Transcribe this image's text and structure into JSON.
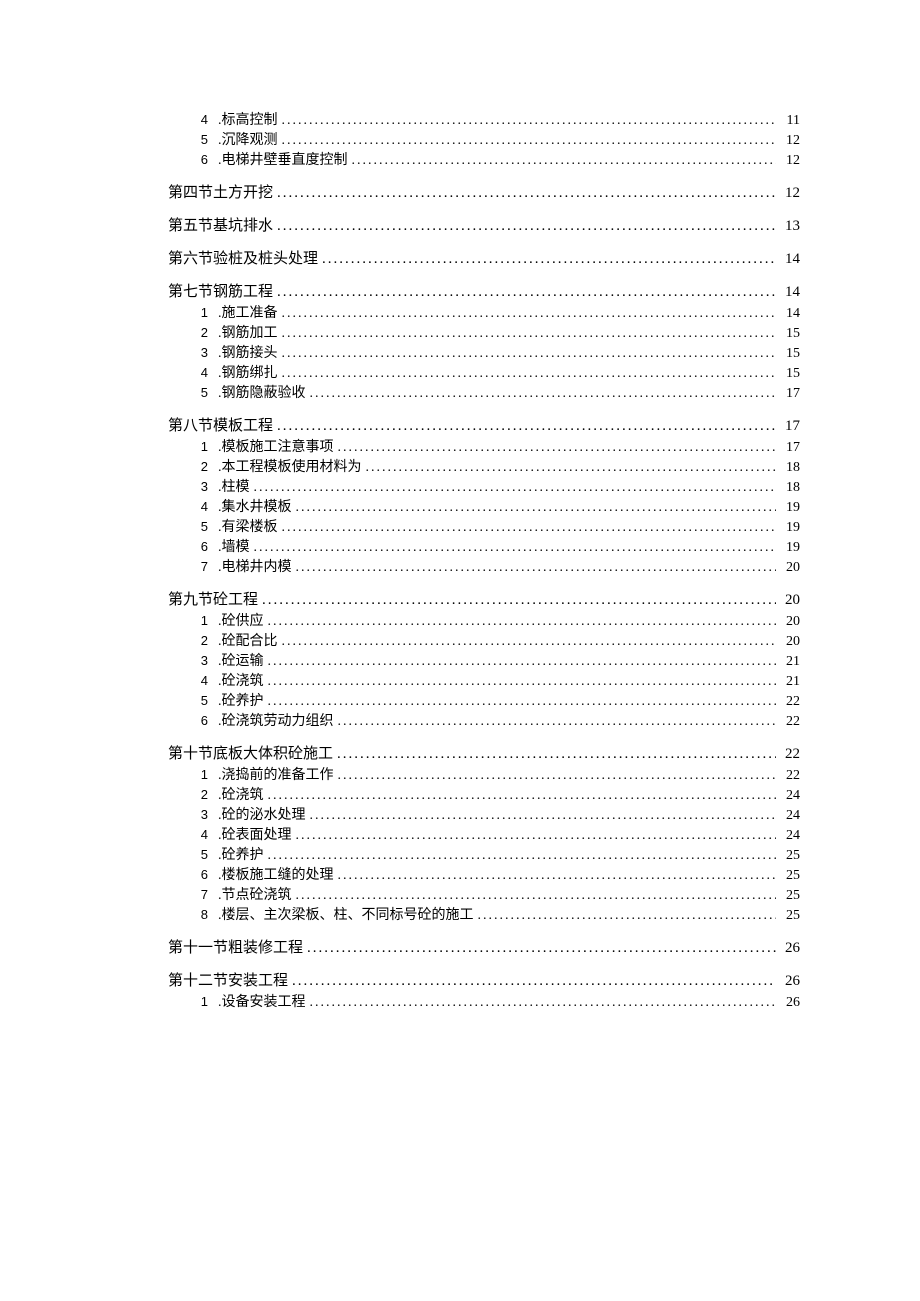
{
  "toc": [
    {
      "level": 2,
      "ord": "4",
      "title": ".标高控制",
      "page": "11"
    },
    {
      "level": 2,
      "ord": "5",
      "title": ".沉降观测",
      "page": "12"
    },
    {
      "level": 2,
      "ord": "6",
      "title": ".电梯井壁垂直度控制",
      "page": "12"
    },
    {
      "level": 1,
      "ord": "",
      "title": "第四节土方开挖",
      "page": "12"
    },
    {
      "level": 1,
      "ord": "",
      "title": "第五节基坑排水",
      "page": "13"
    },
    {
      "level": 1,
      "ord": "",
      "title": "第六节验桩及桩头处理",
      "page": "14"
    },
    {
      "level": 1,
      "ord": "",
      "title": "第七节钢筋工程",
      "page": "14"
    },
    {
      "level": 2,
      "ord": "1",
      "title": ".施工准备",
      "page": "14"
    },
    {
      "level": 2,
      "ord": "2",
      "title": ".钢筋加工",
      "page": "15"
    },
    {
      "level": 2,
      "ord": "3",
      "title": ".钢筋接头",
      "page": "15"
    },
    {
      "level": 2,
      "ord": "4",
      "title": ".钢筋绑扎",
      "page": "15"
    },
    {
      "level": 2,
      "ord": "5",
      "title": ".钢筋隐蔽验收",
      "page": "17"
    },
    {
      "level": 1,
      "ord": "",
      "title": "第八节模板工程",
      "page": "17"
    },
    {
      "level": 2,
      "ord": "1",
      "title": ".模板施工注意事项",
      "page": "17"
    },
    {
      "level": 2,
      "ord": "2",
      "title": ".本工程模板使用材料为",
      "page": "18"
    },
    {
      "level": 2,
      "ord": "3",
      "title": ".柱模",
      "page": "18"
    },
    {
      "level": 2,
      "ord": "4",
      "title": ".集水井模板",
      "page": "19"
    },
    {
      "level": 2,
      "ord": "5",
      "title": ".有梁楼板",
      "page": "19"
    },
    {
      "level": 2,
      "ord": "6",
      "title": ".墙模",
      "page": "19"
    },
    {
      "level": 2,
      "ord": "7",
      "title": ".电梯井内模",
      "page": "20"
    },
    {
      "level": 1,
      "ord": "",
      "title": "第九节砼工程",
      "page": "20"
    },
    {
      "level": 2,
      "ord": "1",
      "title": ".砼供应",
      "page": "20"
    },
    {
      "level": 2,
      "ord": "2",
      "title": ".砼配合比",
      "page": "20"
    },
    {
      "level": 2,
      "ord": "3",
      "title": ".砼运输",
      "page": "21"
    },
    {
      "level": 2,
      "ord": "4",
      "title": ".砼浇筑",
      "page": "21"
    },
    {
      "level": 2,
      "ord": "5",
      "title": ".砼养护",
      "page": "22"
    },
    {
      "level": 2,
      "ord": "6",
      "title": ".砼浇筑劳动力组织",
      "page": "22"
    },
    {
      "level": 1,
      "ord": "",
      "title": "第十节底板大体积砼施工",
      "page": "22"
    },
    {
      "level": 2,
      "ord": "1",
      "title": ".浇捣前的准备工作",
      "page": "22"
    },
    {
      "level": 2,
      "ord": "2",
      "title": ".砼浇筑",
      "page": "24"
    },
    {
      "level": 2,
      "ord": "3",
      "title": ".砼的泌水处理",
      "page": "24"
    },
    {
      "level": 2,
      "ord": "4",
      "title": ".砼表面处理",
      "page": "24"
    },
    {
      "level": 2,
      "ord": "5",
      "title": ".砼养护",
      "page": "25"
    },
    {
      "level": 2,
      "ord": "6",
      "title": ".楼板施工缝的处理",
      "page": "25"
    },
    {
      "level": 2,
      "ord": "7",
      "title": ".节点砼浇筑",
      "page": "25"
    },
    {
      "level": 2,
      "ord": "8",
      "title": ".楼层、主次梁板、柱、不同标号砼的施工",
      "page": "25"
    },
    {
      "level": 1,
      "ord": "",
      "title": "第十一节粗装修工程",
      "page": "26"
    },
    {
      "level": 1,
      "ord": "",
      "title": "第十二节安装工程",
      "page": "26"
    },
    {
      "level": 2,
      "ord": "1",
      "title": ".设备安装工程",
      "page": "26"
    }
  ]
}
